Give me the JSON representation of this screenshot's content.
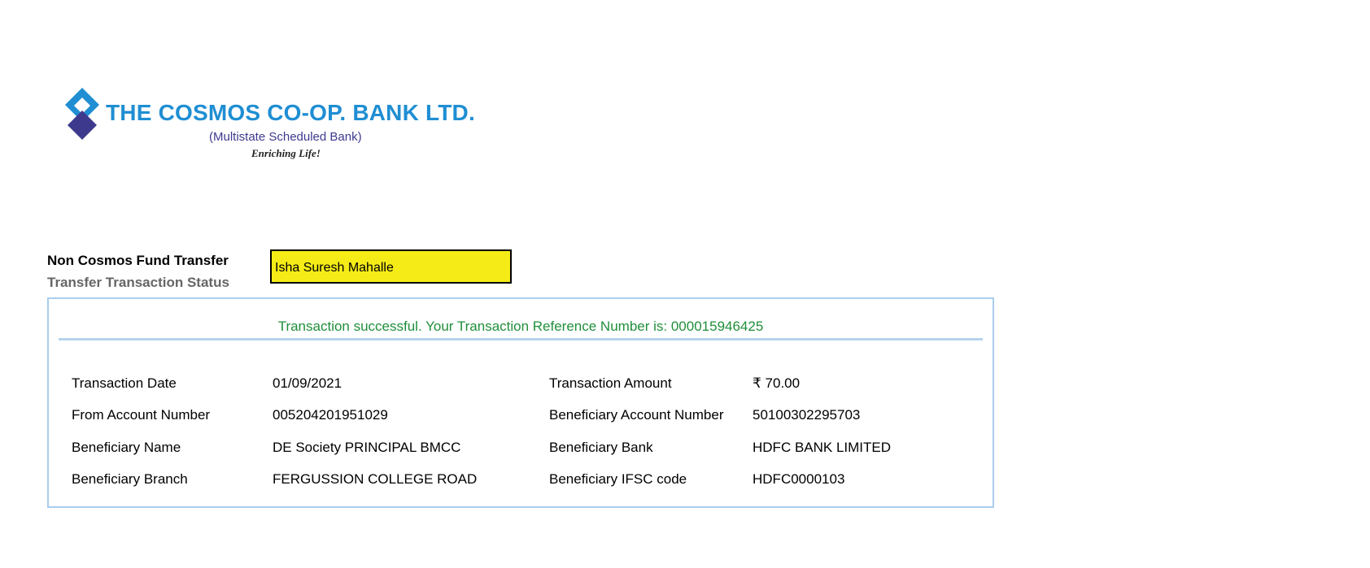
{
  "brand": {
    "name": "THE COSMOS CO-OP. BANK LTD.",
    "subtitle": "(Multistate Scheduled Bank)",
    "tagline": "Enriching Life!",
    "colors": {
      "primary": "#1f8ed3",
      "secondary": "#3d3a8e"
    }
  },
  "header": {
    "title": "Non Cosmos Fund Transfer",
    "subtitle": "Transfer Transaction Status",
    "highlight_name": "Isha Suresh Mahalle",
    "highlight_color": "#f5ec17"
  },
  "status": {
    "message": "Transaction successful. Your Transaction Reference Number is: 000015946425",
    "color": "#1f8f3a"
  },
  "details": [
    {
      "label1": "Transaction Date",
      "value1": "01/09/2021",
      "label2": "Transaction Amount",
      "value2": "₹ 70.00"
    },
    {
      "label1": "From Account Number",
      "value1": "005204201951029",
      "label2": "Beneficiary Account Number",
      "value2": "50100302295703"
    },
    {
      "label1": "Beneficiary Name",
      "value1": "DE Society PRINCIPAL BMCC",
      "label2": "Beneficiary Bank",
      "value2": "HDFC BANK LIMITED"
    },
    {
      "label1": "Beneficiary Branch",
      "value1": "FERGUSSION COLLEGE ROAD",
      "label2": "Beneficiary IFSC code",
      "value2": "HDFC0000103"
    }
  ]
}
